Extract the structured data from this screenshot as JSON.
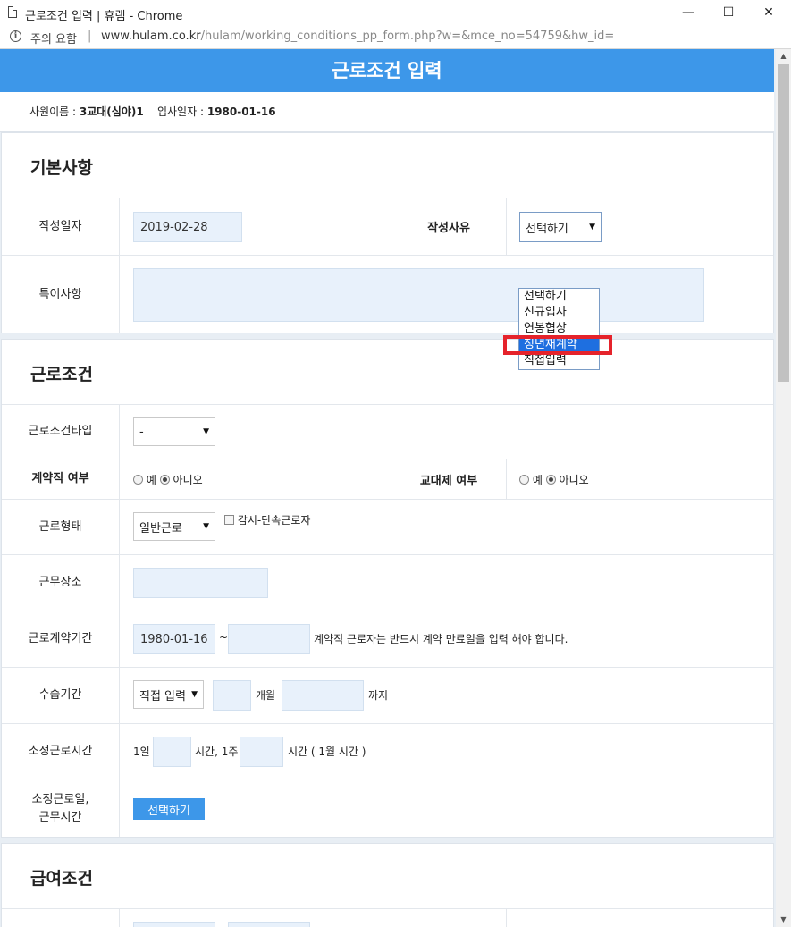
{
  "window": {
    "title": "근로조건 입력 | 휴램 - Chrome",
    "minimize": "—",
    "maximize": "☐",
    "close": "✕"
  },
  "address": {
    "security_label": "주의 요함",
    "separator": "|",
    "url_host": "www.hulam.co.kr",
    "url_path": "/hulam/working_conditions_pp_form.php?w=&mce_no=54759&hw_id="
  },
  "page": {
    "title": "근로조건 입력",
    "employee_name_label": "사원이름 :",
    "employee_name": "3교대(심야)1",
    "hire_date_label": "입사일자 :",
    "hire_date": "1980-01-16"
  },
  "basic": {
    "title": "기본사항",
    "write_date_label": "작성일자",
    "write_date": "2019-02-28",
    "reason_label": "작성사유",
    "reason_selected": "선택하기",
    "reason_options": [
      "선택하기",
      "신규입사",
      "연봉협상",
      "정년재계약",
      "직접입력"
    ],
    "highlighted_option": "정년재계약",
    "notes_label": "특이사항",
    "notes_value": ""
  },
  "conditions": {
    "title": "근로조건",
    "type_label": "근로조건타입",
    "type_value": "-",
    "contract_label": "계약직 여부",
    "contract_yes": "예",
    "contract_no": "아니오",
    "contract_value": "아니오",
    "shift_label": "교대제 여부",
    "shift_yes": "예",
    "shift_no": "아니오",
    "shift_value": "아니오",
    "work_form_label": "근로형태",
    "work_form_value": "일반근로",
    "monitor_label": "감시-단속근로자",
    "workplace_label": "근무장소",
    "workplace_value": "",
    "period_label": "근로계약기간",
    "period_start": "1980-01-16",
    "period_tilde": "~",
    "period_end": "",
    "period_note": "계약직 근로자는 반드시 계약 만료일을 입력 해야 합니다.",
    "probation_label": "수습기간",
    "probation_mode": "직접 입력",
    "probation_months": "",
    "probation_month_unit": "개월",
    "probation_until": "",
    "probation_until_unit": "까지",
    "hours_label": "소정근로시간",
    "hours_day_prefix": "1일",
    "hours_day_value": "",
    "hours_week_prefix": "시간, 1주",
    "hours_week_value": "",
    "hours_suffix": "시간 ( 1월 시간 )",
    "days_label_1": "소정근로일,",
    "days_label_2": "근무시간",
    "days_button": "선택하기"
  },
  "salary": {
    "title": "급여조건"
  }
}
